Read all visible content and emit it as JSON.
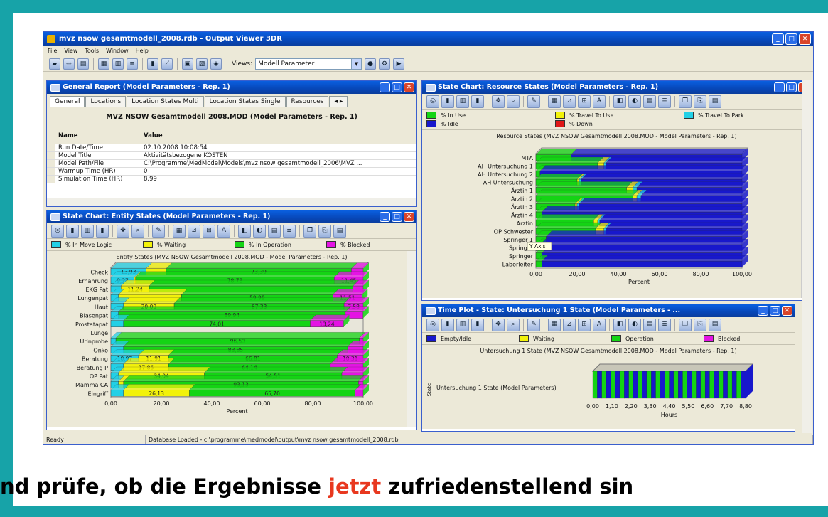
{
  "app": {
    "title": "mvz nsow gesamtmodell_2008.rdb - Output Viewer 3DR",
    "menu": [
      "File",
      "View",
      "Tools",
      "Window",
      "Help"
    ],
    "views_label": "Views:",
    "views_value": "Modell Parameter",
    "status_ready": "Ready",
    "status_db": "Database Loaded - c:\\programme\\medmodel\\output\\mvz nsow gesamtmodell_2008.rdb"
  },
  "general_report": {
    "title": "General Report (Model Parameters - Rep. 1)",
    "tabs": [
      "General",
      "Locations",
      "Location States Multi",
      "Location States Single",
      "Resources"
    ],
    "heading": "MVZ NSOW Gesamtmodell 2008.MOD (Model Parameters - Rep. 1)",
    "col_name": "Name",
    "col_value": "Value",
    "rows": [
      {
        "name": "Run Date/Time",
        "value": "02.10.2008 10:08:54"
      },
      {
        "name": "Model Title",
        "value": "Aktivitätsbezogene KOSTEN"
      },
      {
        "name": "Model Path/File",
        "value": "C:\\Programme\\MedModel\\Models\\mvz nsow gesamtmodell_2006\\MVZ ..."
      },
      {
        "name": "Warmup Time (HR)",
        "value": "0"
      },
      {
        "name": "Simulation Time (HR)",
        "value": "8.99"
      }
    ]
  },
  "entity_states": {
    "title": "State Chart: Entity States (Model Parameters - Rep. 1)",
    "legend": [
      "% In Move Logic",
      "% Waiting",
      "% In Operation",
      "% Blocked"
    ],
    "chart_title": "Entity States (MVZ NSOW Gesamtmodell 2008.MOD - Model Parameters - Rep. 1)",
    "xlabel": "Percent",
    "ticks": [
      "0,00",
      "20,00",
      "40,00",
      "60,00",
      "80,00",
      "100,00"
    ]
  },
  "resource_states": {
    "title": "State Chart: Resource States (Model Parameters - Rep. 1)",
    "legend": [
      "% In Use",
      "% Travel To Use",
      "% Travel To Park",
      "% Idle",
      "% Down"
    ],
    "chart_title": "Resource States (MVZ NSOW Gesamtmodell 2008.MOD - Model Parameters - Rep. 1)",
    "xlabel": "Percent",
    "ticks": [
      "0,00",
      "20,00",
      "40,00",
      "60,00",
      "80,00",
      "100,00"
    ],
    "tooltip": "Y Axis"
  },
  "time_plot": {
    "title": "Time Plot - State: Untersuchung 1 State (Model Parameters - ...",
    "legend": [
      "Empty/Idle",
      "Waiting",
      "Operation",
      "Blocked"
    ],
    "chart_title": "Untersuchung 1 State (MVZ NSOW Gesamtmodell 2008.MOD - Model Parameters - Rep. 1)",
    "ylabel": "State",
    "series_label": "Untersuchung 1 State (Model Parameters)",
    "xlabel": "Hours",
    "ticks": [
      "0,00",
      "1,10",
      "2,20",
      "3,30",
      "4,40",
      "5,50",
      "6,60",
      "7,70",
      "8,80"
    ]
  },
  "colors": {
    "move": "#22d0e6",
    "waiting": "#f2f20a",
    "operation": "#14d414",
    "blocked": "#e413e4",
    "idle": "#1818cc",
    "travel_use": "#f2f20a",
    "travel_park": "#22d0e6",
    "down": "#e01818",
    "window_blue": "#0a4fd0",
    "accent_text": "#e8381f"
  },
  "caption": {
    "before": "nd prüfe, ob die Ergebnisse ",
    "highlight": "jetzt",
    "after": " zufriedenstellend sin"
  },
  "chart_data": [
    {
      "type": "bar",
      "orientation": "horizontal",
      "stacked": true,
      "title": "Entity States (MVZ NSOW Gesamtmodell 2008.MOD - Model Parameters - Rep. 1)",
      "xlabel": "Percent",
      "xlim": [
        0,
        100
      ],
      "categories": [
        "Check",
        "Ernährung",
        "EKG Pat",
        "Lungenpat",
        "Haut",
        "Blasenpat",
        "Prostatapat",
        "Lunge",
        "Urinprobe",
        "Onko",
        "Beratung",
        "Beratung P",
        "OP Pat",
        "Mamma CA",
        "Eingriff"
      ],
      "series": [
        {
          "name": "% In Move Logic",
          "values": [
            13.93,
            9.27,
            4,
            3,
            5,
            3,
            5,
            0,
            2,
            5,
            10.97,
            5,
            3,
            3,
            5
          ]
        },
        {
          "name": "% Waiting",
          "values": [
            8,
            0.5,
            11.24,
            25,
            20.09,
            0,
            0,
            0,
            0,
            0,
            11.91,
            17.86,
            34.04,
            2,
            26.13
          ]
        },
        {
          "name": "% In Operation",
          "values": [
            73.39,
            78.78,
            80.76,
            59.99,
            67.33,
            89.94,
            74.01,
            0,
            96.53,
            88.85,
            66.81,
            64.14,
            54.51,
            93.13,
            65.7
          ]
        },
        {
          "name": "% Blocked",
          "values": [
            4.68,
            11.45,
            4,
            11.51,
            7.58,
            7,
            13.24,
            0,
            1.47,
            6.15,
            10.31,
            13,
            8.45,
            1.87,
            3.17
          ]
        }
      ],
      "data_labels": {
        "Check": [
          "13,93",
          "",
          "73,39",
          ""
        ],
        "Ernährung": [
          "9,27",
          "",
          "78,78",
          "11,45"
        ],
        "EKG Pat": [
          "",
          "11,24",
          "",
          ""
        ],
        "Lungenpat": [
          "",
          "",
          "59,99",
          "11,51"
        ],
        "Haut": [
          "",
          "20,09",
          "67,33",
          "7,58"
        ],
        "Blasenpat": [
          "",
          "",
          "89,94",
          ""
        ],
        "Prostatapat": [
          "",
          "",
          "74,01",
          "13,24"
        ],
        "Lunge": [
          "",
          "",
          "",
          ""
        ],
        "Urinprobe": [
          "",
          "",
          "96,53",
          ""
        ],
        "Onko": [
          "",
          "",
          "88,85",
          ""
        ],
        "Beratung": [
          "10,97",
          "11,91",
          "66,81",
          "10,31"
        ],
        "Beratung P": [
          "",
          "17,86",
          "64,14",
          ""
        ],
        "OP Pat": [
          "",
          "34,04",
          "54,51",
          ""
        ],
        "Mamma CA": [
          "",
          "",
          "93,13",
          ""
        ],
        "Eingriff": [
          "",
          "26,13",
          "65,70",
          ""
        ]
      }
    },
    {
      "type": "bar",
      "orientation": "horizontal",
      "stacked": true,
      "title": "Resource States (MVZ NSOW Gesamtmodell 2008.MOD - Model Parameters - Rep. 1)",
      "xlabel": "Percent",
      "xlim": [
        0,
        100
      ],
      "categories": [
        "MTA",
        "AH Untersuchung 1",
        "AH Untersuchung 2",
        "AH Untersuchung",
        "Ärztin 1",
        "Ärztin 2",
        "Ärztin 3",
        "Ärztin 4",
        "Arztin",
        "OP Schwester",
        "Springer 1",
        "Springer",
        "Springer",
        "Laborleiter"
      ],
      "series": [
        {
          "name": "% In Use",
          "values": [
            17,
            30,
            2,
            20,
            44,
            47,
            19,
            3,
            28,
            29,
            5,
            2,
            3,
            3
          ]
        },
        {
          "name": "% Travel To Use",
          "values": [
            0,
            3,
            0,
            1,
            3,
            2,
            1,
            0,
            2,
            4,
            0,
            0,
            0,
            0
          ]
        },
        {
          "name": "% Travel To Park",
          "values": [
            0,
            1,
            0,
            1,
            2,
            2,
            1,
            0,
            1,
            1,
            0,
            0,
            0,
            0
          ]
        },
        {
          "name": "% Idle",
          "values": [
            83,
            66,
            98,
            78,
            51,
            49,
            79,
            97,
            69,
            66,
            95,
            98,
            97,
            97
          ]
        },
        {
          "name": "% Down",
          "values": [
            0,
            0,
            0,
            0,
            0,
            0,
            0,
            0,
            0,
            0,
            0,
            0,
            0,
            0
          ]
        }
      ]
    },
    {
      "type": "area",
      "title": "Untersuchung 1 State (MVZ NSOW Gesamtmodell 2008.MOD - Model Parameters - Rep. 1)",
      "xlabel": "Hours",
      "ylabel": "State",
      "xlim": [
        0,
        8.8
      ],
      "series": [
        {
          "name": "Untersuchung 1 State (Model Parameters)"
        }
      ],
      "state_sequence": [
        "Operation",
        "Empty/Idle",
        "Operation",
        "Empty/Idle",
        "Operation",
        "Empty/Idle",
        "Operation",
        "Empty/Idle",
        "Operation",
        "Empty/Idle",
        "Operation",
        "Empty/Idle",
        "Operation",
        "Empty/Idle",
        "Operation",
        "Empty/Idle",
        "Operation",
        "Empty/Idle",
        "Operation",
        "Empty/Idle",
        "Operation",
        "Empty/Idle",
        "Operation",
        "Empty/Idle",
        "Operation",
        "Empty/Idle",
        "Operation",
        "Empty/Idle",
        "Operation",
        "Empty/Idle",
        "Operation",
        "Empty/Idle",
        "Operation",
        "Empty/Idle"
      ]
    }
  ]
}
